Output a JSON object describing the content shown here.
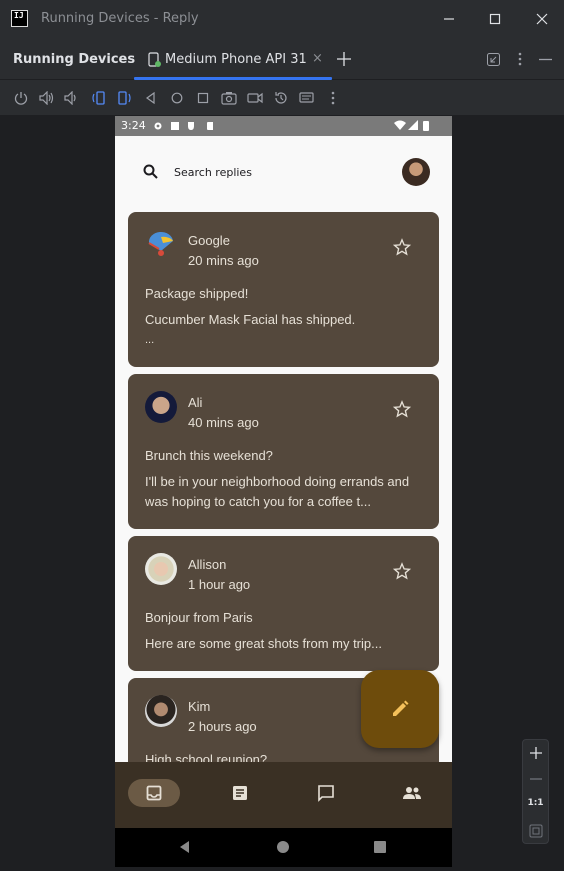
{
  "window": {
    "title": "Running Devices - Reply",
    "app_logo": "IJ"
  },
  "panel": {
    "title": "Running Devices"
  },
  "tabs": [
    {
      "label": "Medium Phone API 31"
    }
  ],
  "device": {
    "status": {
      "time": "3:24"
    },
    "search": {
      "placeholder": "Search replies"
    },
    "emails": [
      {
        "sender": "Google",
        "time": "20 mins ago",
        "subject": "Package shipped!",
        "body": "Cucumber Mask Facial has shipped.",
        "extra": "..."
      },
      {
        "sender": "Ali",
        "time": "40 mins ago",
        "subject": "Brunch this weekend?",
        "body": "I'll be in your neighborhood doing errands and was hoping to catch you for a coffee t..."
      },
      {
        "sender": "Allison",
        "time": "1 hour ago",
        "subject": "Bonjour from Paris",
        "body": "Here are some great shots from my trip..."
      },
      {
        "sender": "Kim",
        "time": "2 hours ago",
        "subject": "High school reunion?",
        "body": ""
      }
    ],
    "nav": [
      "inbox-icon",
      "article-icon",
      "chat-icon",
      "people-icon"
    ]
  },
  "zoom": {
    "ratio": "1:1"
  },
  "colors": {
    "accent": "#3574f0",
    "card": "#54483c",
    "fab": "#6e4c0c",
    "navbar": "#3a3024"
  }
}
